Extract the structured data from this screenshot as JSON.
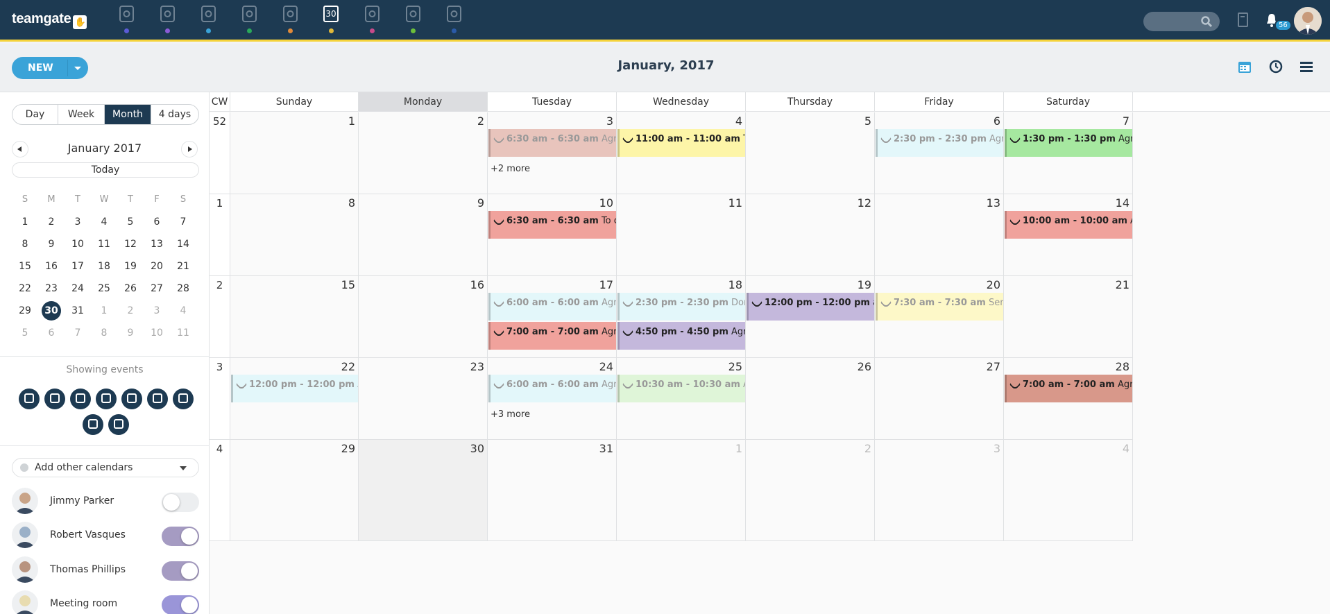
{
  "app": {
    "logo": "teamgate"
  },
  "topnav": {
    "icons": [
      {
        "name": "dashboard-icon",
        "dot": "#5b5bd6"
      },
      {
        "name": "target-icon",
        "dot": "#8b5bd6"
      },
      {
        "name": "companies-icon",
        "dot": "#3aa3d8"
      },
      {
        "name": "people-icon",
        "dot": "#2aa85a"
      },
      {
        "name": "deals-icon",
        "dot": "#e08a3a"
      },
      {
        "name": "calendar-icon",
        "dot": "#e0b83a",
        "label": "30"
      },
      {
        "name": "inbox-icon",
        "dot": "#c84a8a"
      },
      {
        "name": "clipboard-icon",
        "dot": "#6cbf3a"
      },
      {
        "name": "reports-icon",
        "dot": "#2a5aa8"
      }
    ],
    "notifications_count": "56"
  },
  "toolbar": {
    "new_label": "NEW",
    "title": "January, 2017"
  },
  "sidebar": {
    "view_tabs": [
      "Day",
      "Week",
      "Month",
      "4 days"
    ],
    "active_tab": "Month",
    "mini_title": "January 2017",
    "today_label": "Today",
    "weekday_headers": [
      "S",
      "M",
      "T",
      "W",
      "T",
      "F",
      "S"
    ],
    "mini_weeks": [
      [
        "1",
        "2",
        "3",
        "4",
        "5",
        "6",
        "7"
      ],
      [
        "8",
        "9",
        "10",
        "11",
        "12",
        "13",
        "14"
      ],
      [
        "15",
        "16",
        "17",
        "18",
        "19",
        "20",
        "21"
      ],
      [
        "22",
        "23",
        "24",
        "25",
        "26",
        "27",
        "28"
      ],
      [
        "29",
        "30",
        "31",
        "1",
        "2",
        "3",
        "4"
      ],
      [
        "5",
        "6",
        "7",
        "8",
        "9",
        "10",
        "11"
      ]
    ],
    "selected_day": "30",
    "showing_events_label": "Showing events",
    "event_type_icons": [
      "calendar-icon",
      "phone-icon",
      "task-icon",
      "email-icon",
      "gift-icon",
      "megaphone-icon",
      "user-icon",
      "tag-icon",
      "location-icon"
    ],
    "add_calendars_label": "Add other calendars",
    "people": [
      {
        "name": "Jimmy Parker",
        "toggle": "off"
      },
      {
        "name": "Robert Vasques",
        "toggle": "on"
      },
      {
        "name": "Thomas Phillips",
        "toggle": "on"
      },
      {
        "name": "Meeting room",
        "toggle": "on2"
      }
    ]
  },
  "calendar": {
    "cw_label": "CW",
    "weekdays": [
      "Sunday",
      "Monday",
      "Tuesday",
      "Wednesday",
      "Thursday",
      "Friday",
      "Saturday"
    ],
    "weeks": [
      {
        "cw": "52",
        "days": [
          "1",
          "2",
          "3",
          "4",
          "5",
          "6",
          "7"
        ]
      },
      {
        "cw": "1",
        "days": [
          "8",
          "9",
          "10",
          "11",
          "12",
          "13",
          "14"
        ]
      },
      {
        "cw": "2",
        "days": [
          "15",
          "16",
          "17",
          "18",
          "19",
          "20",
          "21"
        ]
      },
      {
        "cw": "3",
        "days": [
          "22",
          "23",
          "24",
          "25",
          "26",
          "27",
          "28"
        ]
      },
      {
        "cw": "4",
        "days": [
          "29",
          "30",
          "31",
          "1",
          "2",
          "3",
          "4"
        ]
      }
    ],
    "events": [
      {
        "w": 0,
        "d": 2,
        "slot": 0,
        "time": "6:30 am - 6:30 am",
        "text": "Agree meeting",
        "bg": "#e8c4bc",
        "fg": "#999",
        "icon": "phone"
      },
      {
        "w": 0,
        "d": 3,
        "slot": 0,
        "time": "11:00 am - 11:00 am",
        "text": "To call Jack",
        "bg": "#fdf5a8",
        "fg": "#222",
        "icon": "phone"
      },
      {
        "w": 0,
        "d": 5,
        "slot": 0,
        "time": "2:30 pm - 2:30 pm",
        "text": "Agree meeting",
        "bg": "#e3f7fa",
        "fg": "#999",
        "icon": "phone"
      },
      {
        "w": 0,
        "d": 6,
        "slot": 0,
        "time": "1:30 pm - 1:30 pm",
        "text": "Agree meeting",
        "bg": "#a6e8a0",
        "fg": "#222",
        "icon": "phone"
      },
      {
        "w": 1,
        "d": 2,
        "slot": 0,
        "time": "6:30 am - 6:30 am",
        "text": "To call Jack about",
        "bg": "#f0a29c",
        "fg": "#222",
        "icon": "phone"
      },
      {
        "w": 1,
        "d": 6,
        "slot": 0,
        "time": "10:00 am - 10:00 am",
        "text": "Agree meeting",
        "bg": "#f0a29c",
        "fg": "#222",
        "icon": "phone"
      },
      {
        "w": 2,
        "d": 2,
        "slot": 0,
        "time": "6:00 am - 6:00 am",
        "text": "Agree meeting",
        "bg": "#e3f7fa",
        "fg": "#999",
        "icon": "phone"
      },
      {
        "w": 2,
        "d": 3,
        "slot": 0,
        "time": "2:30 pm - 2:30 pm",
        "text": "Don't forget to",
        "bg": "#e3f7fa",
        "fg": "#999",
        "icon": "task"
      },
      {
        "w": 2,
        "d": 4,
        "slot": 0,
        "time": "12:00 pm - 12:00 pm",
        "text": "agree upon",
        "bg": "#c4b8dc",
        "fg": "#222",
        "icon": "phone"
      },
      {
        "w": 2,
        "d": 5,
        "slot": 0,
        "time": "7:30 am - 7:30 am",
        "text": "Send more info",
        "bg": "#fdf8c8",
        "fg": "#999",
        "icon": "task"
      },
      {
        "w": 2,
        "d": 2,
        "slot": 1,
        "time": "7:00 am - 7:00 am",
        "text": "Agree meeting",
        "bg": "#f0a29c",
        "fg": "#222",
        "icon": "phone"
      },
      {
        "w": 2,
        "d": 3,
        "slot": 1,
        "time": "4:50 pm - 4:50 pm",
        "text": "Agree upon the",
        "bg": "#c4b8dc",
        "fg": "#222",
        "icon": "phone"
      },
      {
        "w": 3,
        "d": 0,
        "slot": 0,
        "time": "12:00 pm - 12:00 pm",
        "text": "Agree meeting",
        "bg": "#e3f7fa",
        "fg": "#999",
        "icon": "phone"
      },
      {
        "w": 3,
        "d": 2,
        "slot": 0,
        "time": "6:00 am - 6:00 am",
        "text": "Agree meeting",
        "bg": "#e3f7fa",
        "fg": "#999",
        "icon": "phone"
      },
      {
        "w": 3,
        "d": 3,
        "slot": 0,
        "time": "10:30 am - 10:30 am",
        "text": "Ar tiko pasi",
        "bg": "#dff5d8",
        "fg": "#999",
        "icon": "phone"
      },
      {
        "w": 3,
        "d": 6,
        "slot": 0,
        "time": "7:00 am - 7:00 am",
        "text": "Agree meeting",
        "bg": "#d8988a",
        "fg": "#222",
        "icon": "phone"
      }
    ],
    "more": [
      {
        "w": 0,
        "d": 2,
        "label": "+2 more"
      },
      {
        "w": 3,
        "d": 2,
        "label": "+3 more"
      }
    ]
  }
}
